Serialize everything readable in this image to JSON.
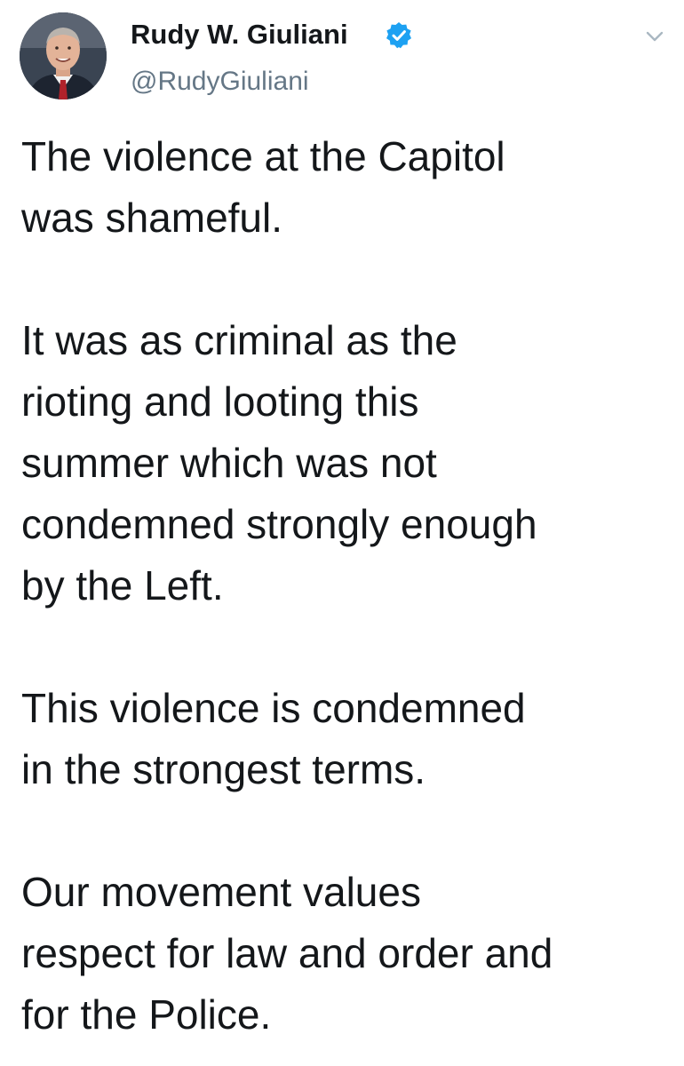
{
  "header": {
    "display_name": "Rudy W. Giuliani",
    "handle": "@RudyGiuliani",
    "verified": true,
    "verified_icon": "verified-badge-icon",
    "menu_icon": "chevron-down-icon"
  },
  "tweet": {
    "paragraphs": [
      "The violence at the Capitol\nwas shameful.",
      "It was as criminal as the\nrioting and looting this\nsummer which was not\ncondemned strongly enough\nby the Left.",
      "This violence is condemned\nin the strongest terms.",
      "Our movement values\nrespect for law and order and\nfor the Police."
    ]
  },
  "colors": {
    "text": "#14171a",
    "secondary_text": "#657786",
    "verified_blue": "#1da1f2",
    "background": "#ffffff"
  }
}
